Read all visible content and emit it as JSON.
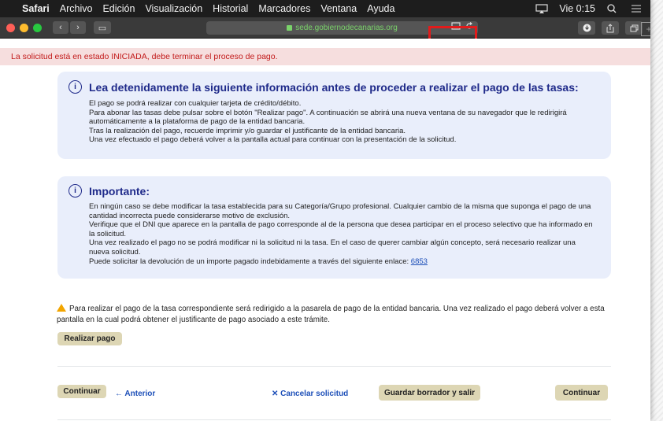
{
  "menubar": {
    "app": "Safari",
    "items": [
      "Archivo",
      "Edición",
      "Visualización",
      "Historial",
      "Marcadores",
      "Ventana",
      "Ayuda"
    ],
    "clock": "Vie 0:15"
  },
  "toolbar": {
    "url": "sede.gobiernodecanarias.org"
  },
  "page": {
    "status_alert": "La solicitud está en estado INICIADA, debe terminar el proceso de pago.",
    "info_box": {
      "title": "Lea detenidamente la siguiente información antes de proceder a realizar el pago de las tasas:",
      "lines": [
        "El pago se podrá realizar con cualquier tarjeta de crédito/débito.",
        "Para abonar las tasas debe pulsar sobre el botón \"Realizar pago\". A continuación se abrirá una nueva ventana de su navegador que le redirigirá automáticamente a la plataforma de pago de la entidad bancaria.",
        "Tras la realización del pago, recuerde imprimir y/o guardar el justificante de la entidad bancaria.",
        "Una vez efectuado el pago deberá volver a la pantalla actual para continuar con la presentación de la solicitud."
      ]
    },
    "important_box": {
      "title": "Importante:",
      "lines": [
        "En ningún caso se debe modificar la tasa establecida para su Categoría/Grupo profesional. Cualquier cambio de la misma que suponga el pago de una cantidad incorrecta puede considerarse motivo de exclusión.",
        "Verifique que el DNI que aparece en la pantalla de pago corresponde al de la persona que desea participar en el proceso selectivo que ha informado en la solicitud.",
        "Una vez realizado el pago no se podrá modificar ni la solicitud ni la tasa. En el caso de querer cambiar algún concepto, será necesario realizar una nueva solicitud.",
        "Puede solicitar la devolución de un importe pagado indebidamente a través del siguiente enlace: "
      ],
      "link_text": "6853"
    },
    "warning_text": "Para realizar el pago de la tasa correspondiente será redirigido a la pasarela de pago de la entidad bancaria. Una vez realizado el pago deberá volver a esta pantalla en la cual podrá obtener el justificante de pago asociado a este trámite.",
    "buttons": {
      "pay": "Realizar pago",
      "continue_left": "Continuar",
      "previous": "← Anterior",
      "cancel": "✕ Cancelar solicitud",
      "save_draft": "Guardar borrador y salir",
      "continue_right": "Continuar"
    }
  },
  "colors": {
    "annotation_red": "#e21b1b",
    "info_box_bg": "#e9eefb",
    "title_blue": "#1f2a8a",
    "button_bg": "#ddd6b4"
  }
}
